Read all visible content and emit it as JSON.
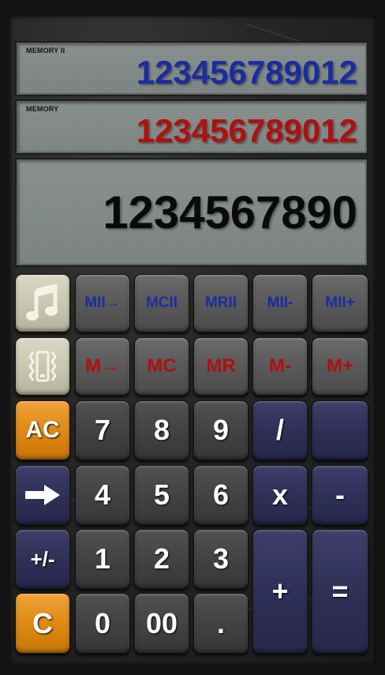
{
  "display": {
    "memory2_label": "MEMORY II",
    "memory2_value": "123456789012",
    "memory_label": "MEMORY",
    "memory_value": "123456789012",
    "main_value": "1234567890"
  },
  "memory2_row": {
    "store": "MII→",
    "clear": "MCII",
    "recall": "MRII",
    "minus": "MII-",
    "plus": "MII+"
  },
  "memory_row": {
    "store": "M→",
    "clear": "MC",
    "recall": "MR",
    "minus": "M-",
    "plus": "M+"
  },
  "keys": {
    "ac": "AC",
    "seven": "7",
    "eight": "8",
    "nine": "9",
    "divide": "/",
    "four": "4",
    "five": "5",
    "six": "6",
    "multiply": "x",
    "subtract": "-",
    "sign": "+/-",
    "one": "1",
    "two": "2",
    "three": "3",
    "add": "+",
    "equals": "=",
    "clear": "C",
    "zero": "0",
    "double_zero": "00",
    "decimal": "."
  },
  "icons": {
    "sound": "music-note-icon",
    "vibrate": "vibrate-icon",
    "backspace": "arrow-right-icon"
  },
  "colors": {
    "memory2_text": "#1a2d9e",
    "memory_text": "#b01010",
    "main_text": "#0a0a0a",
    "accent_orange": "#df8a14",
    "operator_navy": "#2f3058"
  }
}
